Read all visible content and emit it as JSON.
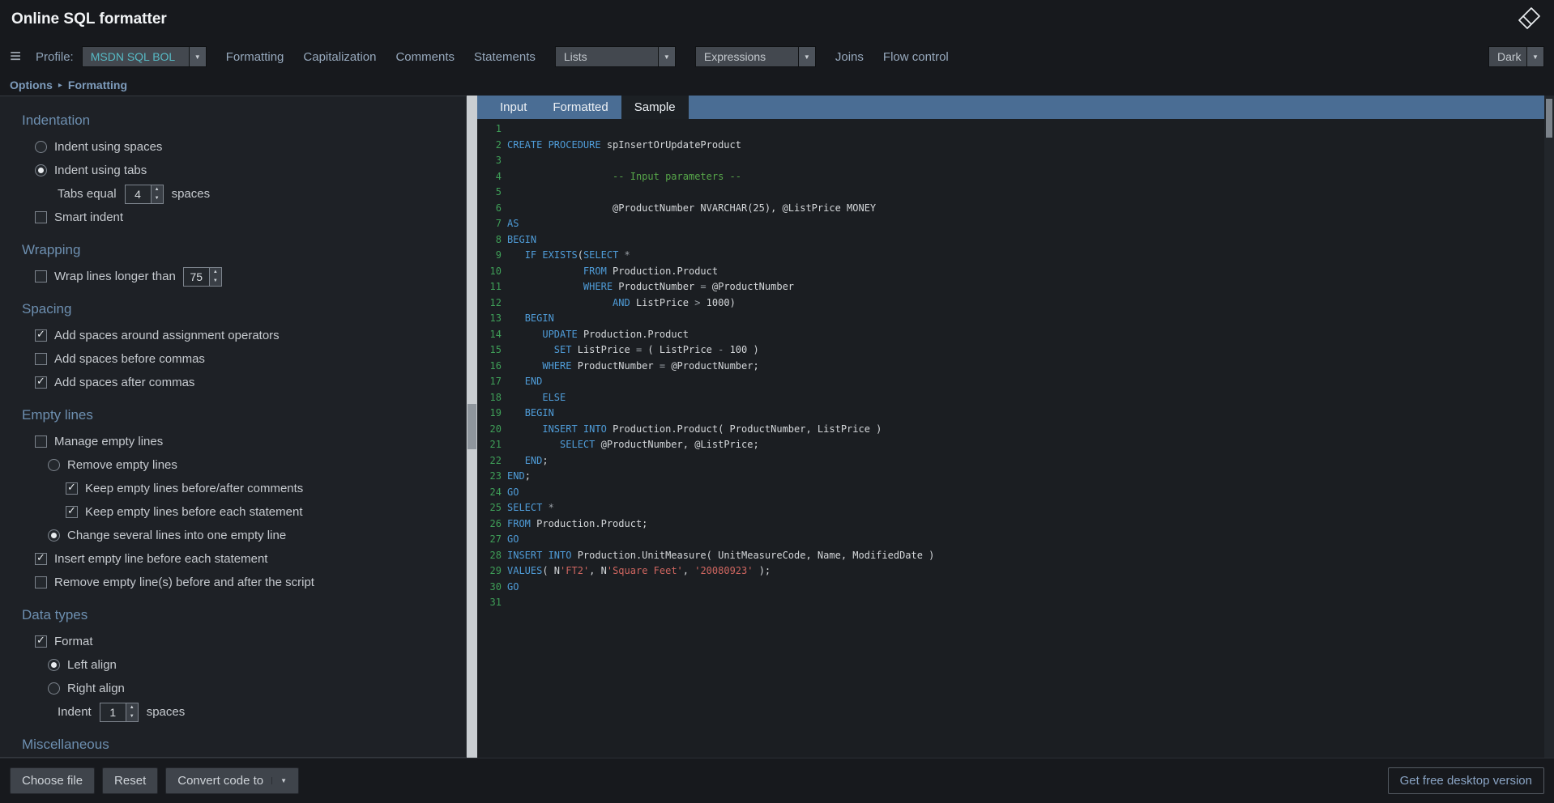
{
  "header": {
    "title": "Online SQL formatter"
  },
  "icons": {
    "menu": "≡",
    "chevron_down": "▼",
    "spinner_up": "▲",
    "spinner_down": "▼",
    "check": "✓"
  },
  "toolbar": {
    "profile_label": "Profile:",
    "profile_value": "MSDN SQL BOL",
    "formatting": "Formatting",
    "capitalization": "Capitalization",
    "comments": "Comments",
    "statements": "Statements",
    "lists": "Lists",
    "expressions": "Expressions",
    "joins": "Joins",
    "flow_control": "Flow control",
    "theme": "Dark"
  },
  "breadcrumb": {
    "root": "Options",
    "separator": "▸",
    "section": "Formatting"
  },
  "options": {
    "indentation": {
      "title": "Indentation",
      "indent_spaces": {
        "label": "Indent using spaces",
        "checked": false
      },
      "indent_tabs": {
        "label": "Indent using tabs",
        "checked": true
      },
      "tabs_equal": {
        "prefix": "Tabs equal",
        "value": "4",
        "suffix": "spaces"
      },
      "smart_indent": {
        "label": "Smart indent",
        "checked": false
      }
    },
    "wrapping": {
      "title": "Wrapping",
      "wrap_lines": {
        "label": "Wrap lines longer than",
        "value": "75",
        "checked": false
      }
    },
    "spacing": {
      "title": "Spacing",
      "items": [
        {
          "label": "Add spaces around assignment operators",
          "checked": true
        },
        {
          "label": "Add spaces before commas",
          "checked": false
        },
        {
          "label": "Add spaces after commas",
          "checked": true
        }
      ]
    },
    "empty_lines": {
      "title": "Empty lines",
      "manage": {
        "label": "Manage empty lines",
        "checked": false
      },
      "remove": {
        "label": "Remove empty lines",
        "checked": false
      },
      "keep_comments": {
        "label": "Keep empty lines before/after comments",
        "checked": true
      },
      "keep_statement": {
        "label": "Keep empty lines before each statement",
        "checked": true
      },
      "change_several": {
        "label": "Change several lines into one empty line",
        "checked": true
      },
      "insert_before": {
        "label": "Insert empty line before each statement",
        "checked": true
      },
      "remove_script": {
        "label": "Remove empty line(s) before and after the script",
        "checked": false
      }
    },
    "data_types": {
      "title": "Data types",
      "format": {
        "label": "Format",
        "checked": true
      },
      "left_align": {
        "label": "Left align",
        "checked": true
      },
      "right_align": {
        "label": "Right align",
        "checked": false
      },
      "indent": {
        "prefix": "Indent",
        "value": "1",
        "suffix": "spaces"
      }
    },
    "miscellaneous": {
      "title": "Miscellaneous"
    }
  },
  "editor": {
    "tabs": [
      {
        "label": "Input"
      },
      {
        "label": "Formatted"
      },
      {
        "label": "Sample"
      }
    ],
    "active_tab": "Sample",
    "token_colors": {
      "k": "#4f9cd8",
      "c": "#57a64a",
      "s": "#cf6660",
      "o": "#9aa0a6",
      "t": "#d4d7da",
      "line_number": "#3f9f58"
    },
    "lines": [
      {
        "n": "1",
        "t": []
      },
      {
        "n": "2",
        "t": [
          [
            "k",
            "CREATE PROCEDURE"
          ],
          [
            "t",
            " spInsertOrUpdateProduct"
          ]
        ]
      },
      {
        "n": "3",
        "t": []
      },
      {
        "n": "4",
        "t": [
          [
            "t",
            "                  "
          ],
          [
            "c",
            "-- Input parameters --"
          ]
        ]
      },
      {
        "n": "5",
        "t": []
      },
      {
        "n": "6",
        "t": [
          [
            "t",
            "                  @ProductNumber NVARCHAR(25), @ListPrice MONEY"
          ]
        ]
      },
      {
        "n": "7",
        "t": [
          [
            "k",
            "AS"
          ]
        ]
      },
      {
        "n": "8",
        "t": [
          [
            "k",
            "BEGIN"
          ]
        ]
      },
      {
        "n": "9",
        "t": [
          [
            "t",
            "   "
          ],
          [
            "k",
            "IF EXISTS"
          ],
          [
            "t",
            "("
          ],
          [
            "k",
            "SELECT"
          ],
          [
            "t",
            " "
          ],
          [
            "o",
            "*"
          ]
        ]
      },
      {
        "n": "10",
        "t": [
          [
            "t",
            "             "
          ],
          [
            "k",
            "FROM"
          ],
          [
            "t",
            " Production.Product"
          ]
        ]
      },
      {
        "n": "11",
        "t": [
          [
            "t",
            "             "
          ],
          [
            "k",
            "WHERE"
          ],
          [
            "t",
            " ProductNumber "
          ],
          [
            "o",
            "="
          ],
          [
            "t",
            " @ProductNumber"
          ]
        ]
      },
      {
        "n": "12",
        "t": [
          [
            "t",
            "                  "
          ],
          [
            "k",
            "AND"
          ],
          [
            "t",
            " ListPrice "
          ],
          [
            "o",
            ">"
          ],
          [
            "t",
            " 1000)"
          ]
        ]
      },
      {
        "n": "13",
        "t": [
          [
            "t",
            "   "
          ],
          [
            "k",
            "BEGIN"
          ]
        ]
      },
      {
        "n": "14",
        "t": [
          [
            "t",
            "      "
          ],
          [
            "k",
            "UPDATE"
          ],
          [
            "t",
            " Production.Product"
          ]
        ]
      },
      {
        "n": "15",
        "t": [
          [
            "t",
            "        "
          ],
          [
            "k",
            "SET"
          ],
          [
            "t",
            " ListPrice "
          ],
          [
            "o",
            "="
          ],
          [
            "t",
            " ( ListPrice "
          ],
          [
            "o",
            "-"
          ],
          [
            "t",
            " 100 )"
          ]
        ]
      },
      {
        "n": "16",
        "t": [
          [
            "t",
            "      "
          ],
          [
            "k",
            "WHERE"
          ],
          [
            "t",
            " ProductNumber "
          ],
          [
            "o",
            "="
          ],
          [
            "t",
            " @ProductNumber;"
          ]
        ]
      },
      {
        "n": "17",
        "t": [
          [
            "t",
            "   "
          ],
          [
            "k",
            "END"
          ]
        ]
      },
      {
        "n": "18",
        "t": [
          [
            "t",
            "      "
          ],
          [
            "k",
            "ELSE"
          ]
        ]
      },
      {
        "n": "19",
        "t": [
          [
            "t",
            "   "
          ],
          [
            "k",
            "BEGIN"
          ]
        ]
      },
      {
        "n": "20",
        "t": [
          [
            "t",
            "      "
          ],
          [
            "k",
            "INSERT INTO"
          ],
          [
            "t",
            " Production.Product( ProductNumber, ListPrice )"
          ]
        ]
      },
      {
        "n": "21",
        "t": [
          [
            "t",
            "         "
          ],
          [
            "k",
            "SELECT"
          ],
          [
            "t",
            " @ProductNumber, @ListPrice;"
          ]
        ]
      },
      {
        "n": "22",
        "t": [
          [
            "t",
            "   "
          ],
          [
            "k",
            "END"
          ],
          [
            "t",
            ";"
          ]
        ]
      },
      {
        "n": "23",
        "t": [
          [
            "k",
            "END"
          ],
          [
            "t",
            ";"
          ]
        ]
      },
      {
        "n": "24",
        "t": [
          [
            "k",
            "GO"
          ]
        ]
      },
      {
        "n": "25",
        "t": [
          [
            "k",
            "SELECT"
          ],
          [
            "t",
            " "
          ],
          [
            "o",
            "*"
          ]
        ]
      },
      {
        "n": "26",
        "t": [
          [
            "k",
            "FROM"
          ],
          [
            "t",
            " Production.Product;"
          ]
        ]
      },
      {
        "n": "27",
        "t": [
          [
            "k",
            "GO"
          ]
        ]
      },
      {
        "n": "28",
        "t": [
          [
            "k",
            "INSERT INTO"
          ],
          [
            "t",
            " Production.UnitMeasure( UnitMeasureCode, Name, ModifiedDate )"
          ]
        ]
      },
      {
        "n": "29",
        "t": [
          [
            "k",
            "VALUES"
          ],
          [
            "t",
            "( N"
          ],
          [
            "s",
            "'FT2'"
          ],
          [
            "t",
            ", N"
          ],
          [
            "s",
            "'Square Feet'"
          ],
          [
            "t",
            ", "
          ],
          [
            "s",
            "'20080923'"
          ],
          [
            "t",
            " );"
          ]
        ]
      },
      {
        "n": "30",
        "t": [
          [
            "k",
            "GO"
          ]
        ]
      },
      {
        "n": "31",
        "t": []
      }
    ]
  },
  "footer": {
    "choose_file": "Choose file",
    "reset": "Reset",
    "convert": "Convert code to",
    "desktop": "Get free desktop version"
  },
  "colors": {
    "tab_bar": "#4a6d94",
    "section_heading": "#6d8fb0",
    "profile_text": "#57bac5",
    "desktop_button_text": "#8aa4c4"
  }
}
